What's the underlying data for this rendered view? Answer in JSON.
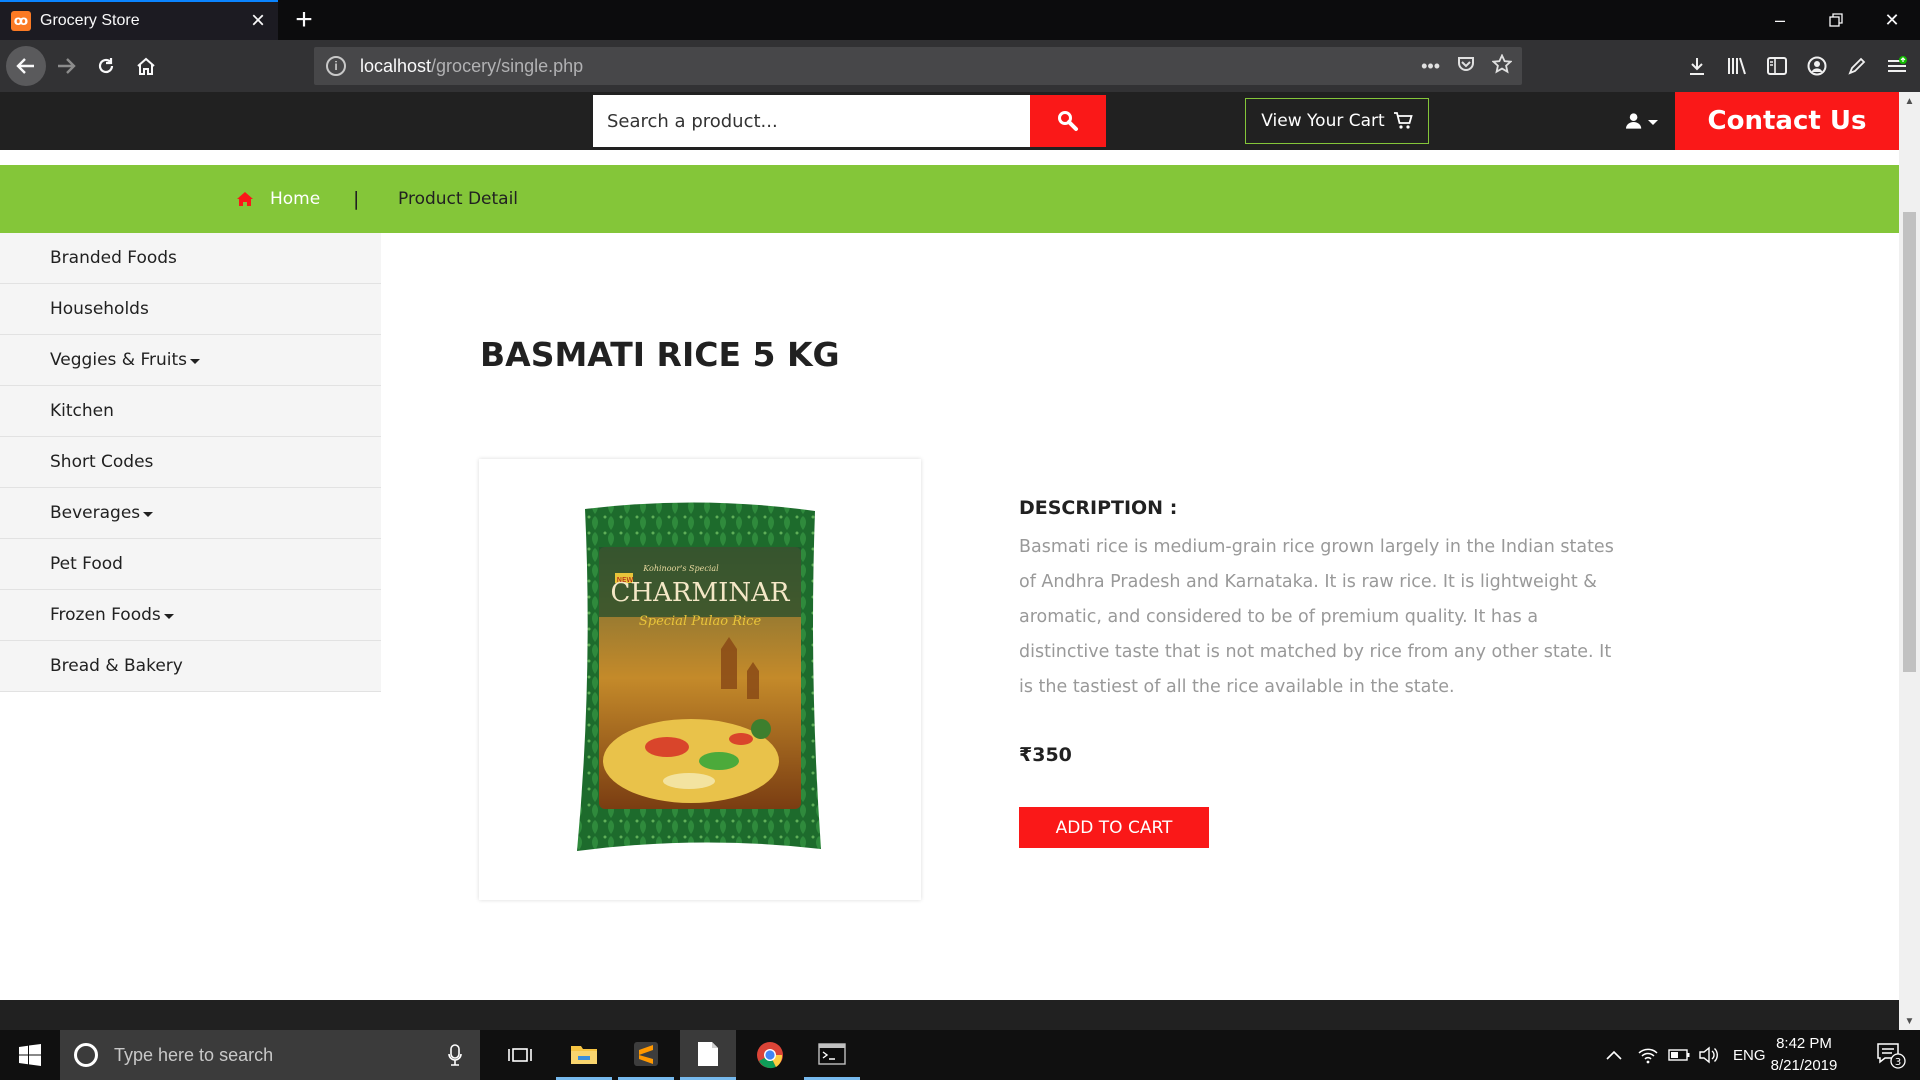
{
  "browser": {
    "tab_title": "Grocery Store",
    "url_host": "localhost",
    "url_path": "/grocery/single.php"
  },
  "header": {
    "search_placeholder": "Search a product...",
    "cart_label": "View Your Cart",
    "contact_label": "Contact Us"
  },
  "breadcrumb": {
    "home": "Home",
    "separator": "|",
    "current": "Product Detail"
  },
  "sidebar": {
    "items": [
      {
        "label": "Branded Foods",
        "dropdown": false
      },
      {
        "label": "Households",
        "dropdown": false
      },
      {
        "label": "Veggies & Fruits",
        "dropdown": true
      },
      {
        "label": "Kitchen",
        "dropdown": false
      },
      {
        "label": "Short Codes",
        "dropdown": false
      },
      {
        "label": "Beverages",
        "dropdown": true
      },
      {
        "label": "Pet Food",
        "dropdown": false
      },
      {
        "label": "Frozen Foods",
        "dropdown": true
      },
      {
        "label": "Bread & Bakery",
        "dropdown": false
      }
    ]
  },
  "product": {
    "title": "BASMATI RICE 5 KG",
    "image_brand": "CHARMINAR",
    "image_subbrand": "Special Pulao Rice",
    "image_maker": "Kohinoor's Special",
    "image_badge": "NEW",
    "description_heading": "DESCRIPTION :",
    "description": "Basmati rice is medium-grain rice grown largely in the Indian states of Andhra Pradesh and Karnataka. It is raw rice. It is lightweight & aromatic, and considered to be of premium quality. It has a distinctive taste that is not matched by rice from any other state. It is the tastiest of all the rice available in the state.",
    "price": "₹350",
    "add_to_cart": "ADD TO CART"
  },
  "taskbar": {
    "search_placeholder": "Type here to search",
    "language": "ENG",
    "time": "8:42 PM",
    "date": "8/21/2019",
    "notification_count": "3"
  },
  "colors": {
    "accent_red": "#fa1818",
    "accent_green": "#84c639",
    "header_dark": "#212121"
  }
}
